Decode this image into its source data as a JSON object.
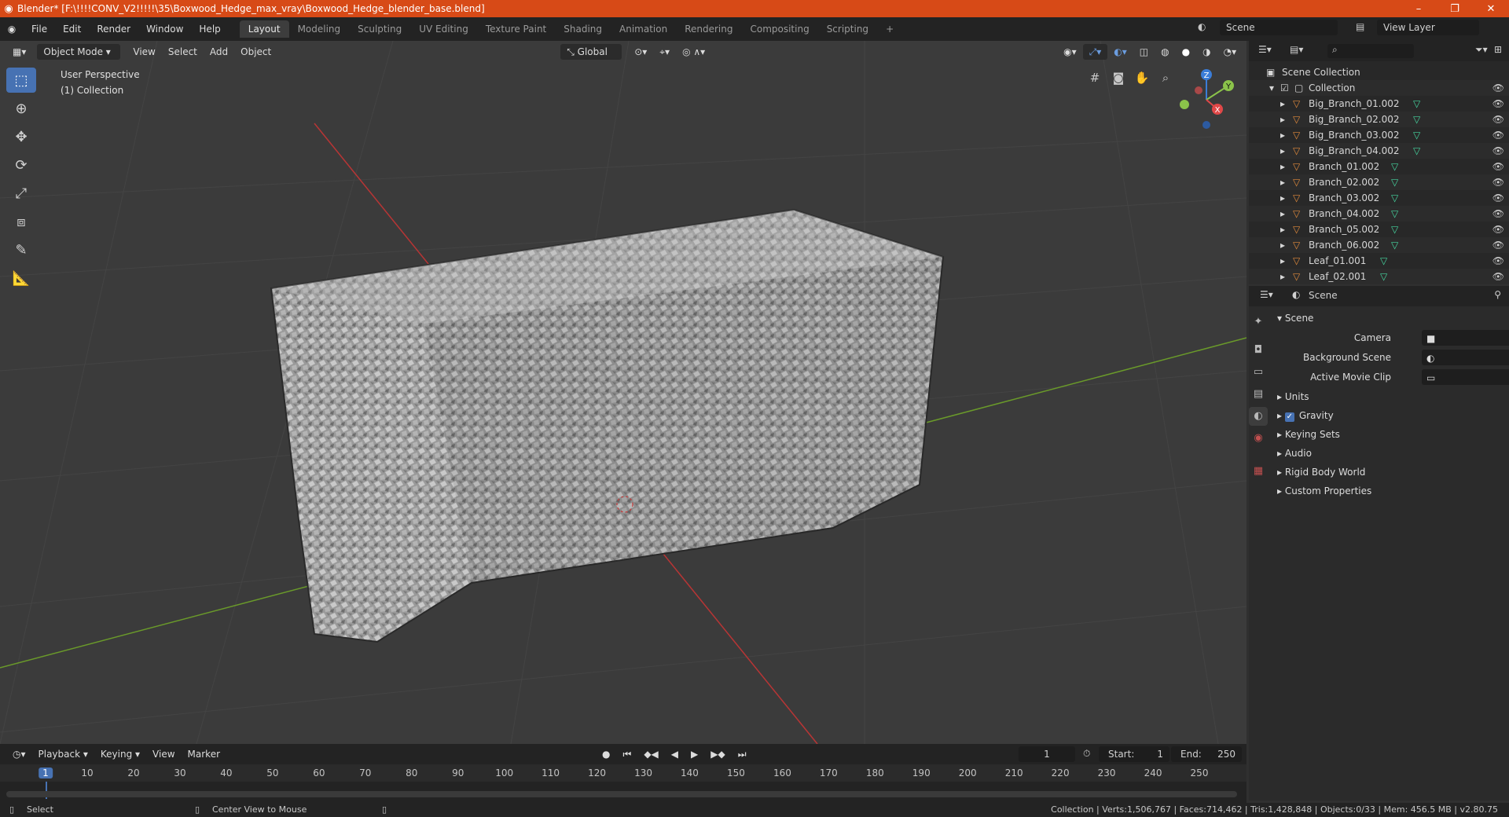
{
  "titlebar": {
    "title": "Blender* [F:\\!!!!CONV_V2!!!!!\\35\\Boxwood_Hedge_max_vray\\Boxwood_Hedge_blender_base.blend]",
    "minimize": "–",
    "maximize": "❐",
    "close": "✕"
  },
  "menu": [
    "File",
    "Edit",
    "Render",
    "Window",
    "Help"
  ],
  "workspaces": [
    "Layout",
    "Modeling",
    "Sculpting",
    "UV Editing",
    "Texture Paint",
    "Shading",
    "Animation",
    "Rendering",
    "Compositing",
    "Scripting"
  ],
  "add_workspace": "+",
  "scene_name": "Scene",
  "view_layer": "View Layer",
  "viewport": {
    "mode": "Object Mode",
    "menus": [
      "View",
      "Select",
      "Add",
      "Object"
    ],
    "orientation": "Global",
    "info_line1": "User Perspective",
    "info_line2": "(1) Collection",
    "gizmo": {
      "z": "Z",
      "y": "Y",
      "x": "X"
    }
  },
  "outliner": {
    "root": "Scene Collection",
    "collection": "Collection",
    "items": [
      "Big_Branch_01.002",
      "Big_Branch_02.002",
      "Big_Branch_03.002",
      "Big_Branch_04.002",
      "Branch_01.002",
      "Branch_02.002",
      "Branch_03.002",
      "Branch_04.002",
      "Branch_05.002",
      "Branch_06.002",
      "Leaf_01.001",
      "Leaf_02.001"
    ]
  },
  "properties": {
    "header": "Scene",
    "section": "Scene",
    "camera_label": "Camera",
    "background_label": "Background Scene",
    "movieclip_label": "Active Movie Clip",
    "panels": [
      "Units",
      "Gravity",
      "Keying Sets",
      "Audio",
      "Rigid Body World",
      "Custom Properties"
    ],
    "gravity_checked": true
  },
  "timeline": {
    "menus": [
      "Playback",
      "Keying",
      "View",
      "Marker"
    ],
    "current_frame": "1",
    "start_label": "Start:",
    "start": "1",
    "end_label": "End:",
    "end": "250",
    "ticks": [
      "1",
      "10",
      "20",
      "30",
      "40",
      "50",
      "60",
      "70",
      "80",
      "90",
      "100",
      "110",
      "120",
      "130",
      "140",
      "150",
      "160",
      "170",
      "180",
      "190",
      "200",
      "210",
      "220",
      "230",
      "240",
      "250"
    ]
  },
  "status": {
    "select": "Select",
    "center": "Center View to Mouse",
    "stats": "Collection | Verts:1,506,767 | Faces:714,462 | Tris:1,428,848 | Objects:0/33 | Mem: 456.5 MB | v2.80.75"
  },
  "colors": {
    "accent": "#4772b3",
    "titlebar": "#d74a17",
    "x_axis": "#c43a3a",
    "y_axis": "#6a9a2a"
  }
}
